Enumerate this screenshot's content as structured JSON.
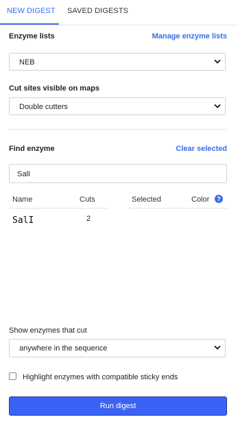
{
  "tabs": [
    {
      "label": "NEW DIGEST",
      "active": true
    },
    {
      "label": "SAVED DIGESTS",
      "active": false
    }
  ],
  "enzyme_lists": {
    "label": "Enzyme lists",
    "manage_link": "Manage enzyme lists",
    "selected": "NEB"
  },
  "cut_sites": {
    "label": "Cut sites visible on maps",
    "selected": "Double cutters"
  },
  "find_enzyme": {
    "label": "Find enzyme",
    "clear_link": "Clear selected",
    "search_value": "SalI"
  },
  "table": {
    "headers": {
      "name": "Name",
      "cuts": "Cuts",
      "selected": "Selected",
      "color": "Color"
    },
    "help_icon": "question-circle-icon",
    "rows": [
      {
        "name": "SalI",
        "cuts": "2"
      }
    ]
  },
  "show_enzymes": {
    "label": "Show enzymes that cut",
    "selected": "anywhere in the sequence"
  },
  "highlight": {
    "label": "Highlight enzymes with compatible sticky ends",
    "checked": false
  },
  "run_button": {
    "label": "Run digest"
  },
  "colors": {
    "accent": "#3a6ee8",
    "button": "#3a63f5"
  }
}
